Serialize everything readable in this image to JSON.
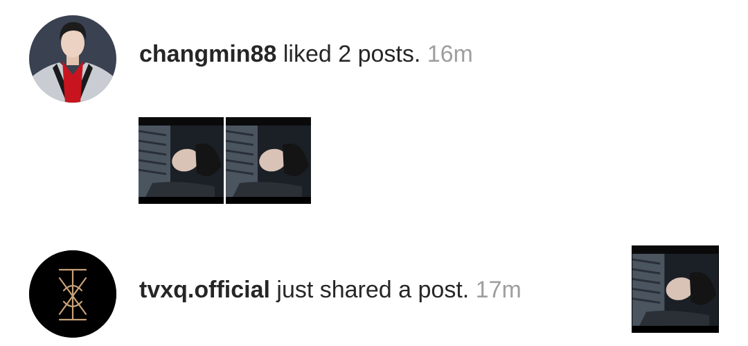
{
  "notifications": [
    {
      "username": "changmin88",
      "action": " liked 2 posts.",
      "time": " 16m",
      "avatar_icon": "profile-photo",
      "thumbnail_count": 2
    },
    {
      "username": "tvxq.official",
      "action": " just shared a post.",
      "time": " 17m",
      "avatar_icon": "tvxq-logo",
      "thumbnail_count": 1
    }
  ],
  "colors": {
    "text": "#262626",
    "time": "#9e9e9e",
    "logo_gold": "#c9a27a",
    "accent_red": "#c8141e"
  }
}
